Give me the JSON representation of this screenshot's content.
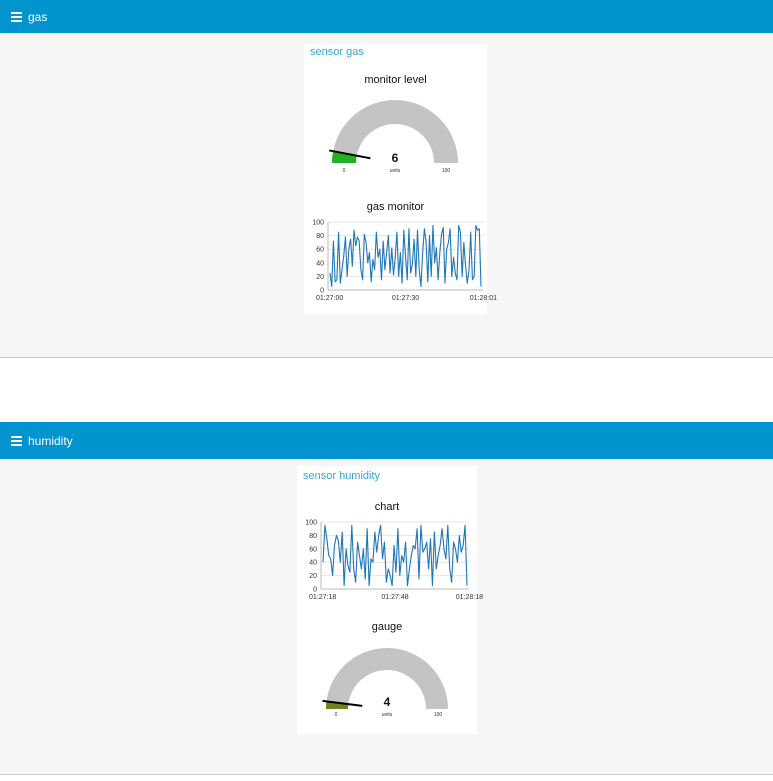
{
  "gas": {
    "toolbar": {
      "title": "gas",
      "menu_icon": "hamburger-menu-icon"
    },
    "group_title": "sensor gas",
    "gauge": {
      "title": "monitor level",
      "value": 6,
      "display_value": "6",
      "units": "units",
      "min": 0,
      "max": 100,
      "min_label": "0",
      "max_label": "100",
      "fill_color": "#21b321",
      "track_color": "#c4c4c4"
    },
    "chart": {
      "title": "gas monitor",
      "x_ticks": [
        "01:27:00",
        "01:27:30",
        "01:28:01"
      ],
      "y_ticks": [
        "100",
        "80",
        "60",
        "40",
        "20",
        "0"
      ]
    }
  },
  "humidity": {
    "toolbar": {
      "title": "humidity",
      "menu_icon": "hamburger-menu-icon"
    },
    "group_title": "sensor humidity",
    "chart": {
      "title": "chart",
      "x_ticks": [
        "01:27:18",
        "01:27:48",
        "01:28:18"
      ],
      "y_ticks": [
        "100",
        "80",
        "60",
        "40",
        "20",
        "0"
      ]
    },
    "gauge": {
      "title": "gauge",
      "value": 4,
      "display_value": "4",
      "units": "units",
      "min": 0,
      "max": 100,
      "min_label": "0",
      "max_label": "100",
      "fill_color": "#6a8520",
      "track_color": "#c4c4c4"
    }
  },
  "chart_data": [
    {
      "type": "line",
      "title": "gas monitor",
      "xlabel": "",
      "ylabel": "",
      "ylim": [
        0,
        100
      ],
      "x_ticks": [
        "01:27:00",
        "01:27:30",
        "01:28:01"
      ],
      "line_color": "#1f77b4",
      "series": [
        {
          "values": [
            25,
            5,
            72,
            12,
            15,
            85,
            10,
            30,
            50,
            78,
            20,
            60,
            75,
            35,
            88,
            65,
            78,
            72,
            30,
            15,
            82,
            70,
            40,
            55,
            12,
            45,
            30,
            85,
            48,
            60,
            15,
            72,
            30,
            55,
            80,
            25,
            62,
            22,
            48,
            85,
            20,
            55,
            10,
            88,
            50,
            15,
            90,
            25,
            38,
            75,
            20,
            88,
            30,
            5,
            55,
            90,
            70,
            12,
            80,
            20,
            95,
            40,
            62,
            15,
            55,
            82,
            92,
            10,
            60,
            70,
            90,
            20,
            48,
            25,
            15,
            95,
            85,
            20,
            70,
            35,
            10,
            28,
            85,
            15,
            20,
            95,
            88,
            90,
            5
          ]
        }
      ]
    },
    {
      "type": "line",
      "title": "chart",
      "xlabel": "",
      "ylabel": "",
      "ylim": [
        0,
        100
      ],
      "x_ticks": [
        "01:27:18",
        "01:27:48",
        "01:28:18"
      ],
      "line_color": "#1f77b4",
      "series": [
        {
          "values": [
            40,
            95,
            75,
            50,
            45,
            20,
            65,
            80,
            72,
            40,
            85,
            5,
            60,
            35,
            25,
            95,
            30,
            10,
            70,
            50,
            30,
            60,
            15,
            90,
            5,
            45,
            40,
            85,
            55,
            80,
            95,
            45,
            70,
            10,
            30,
            20,
            5,
            65,
            25,
            90,
            20,
            50,
            40,
            70,
            5,
            30,
            50,
            65,
            60,
            90,
            15,
            95,
            55,
            60,
            70,
            30,
            75,
            5,
            85,
            30,
            50,
            65,
            90,
            60,
            45,
            95,
            30,
            10,
            70,
            60,
            40,
            80,
            55,
            65,
            95,
            5
          ]
        }
      ]
    },
    {
      "type": "gauge",
      "title": "monitor level",
      "value": 6,
      "units": "units",
      "min": 0,
      "max": 100
    },
    {
      "type": "gauge",
      "title": "gauge",
      "value": 4,
      "units": "units",
      "min": 0,
      "max": 100
    }
  ]
}
